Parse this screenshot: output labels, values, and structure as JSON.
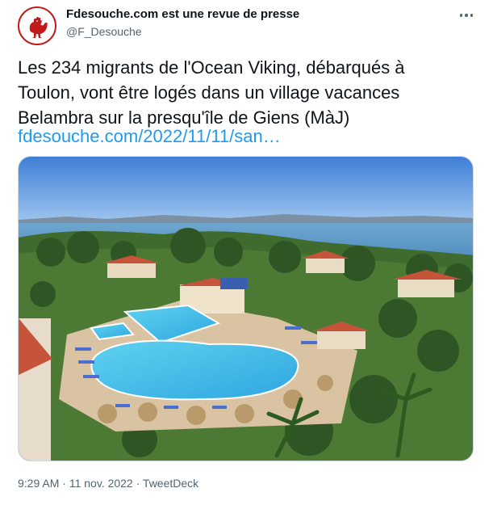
{
  "tweet": {
    "display_name": "Fdesouche.com est une revue de presse",
    "handle": "@F_Desouche",
    "text_lines": [
      "Les 234 migrants de l'Ocean Viking, débarqués à",
      "Toulon, vont être logés dans un village vacances",
      "Belambra sur la presqu'île de Giens (MàJ)"
    ],
    "link": "fdesouche.com/2022/11/11/san…",
    "time": "9:29 AM",
    "separator": " · ",
    "date": "11 nov. 2022",
    "source": "TweetDeck"
  },
  "icons": {
    "avatar": "rooster-logo-icon",
    "more": "more-dots-icon"
  },
  "colors": {
    "link": "#1d9bf0",
    "brand_red": "#c21a1a",
    "secondary_text": "#536471"
  }
}
